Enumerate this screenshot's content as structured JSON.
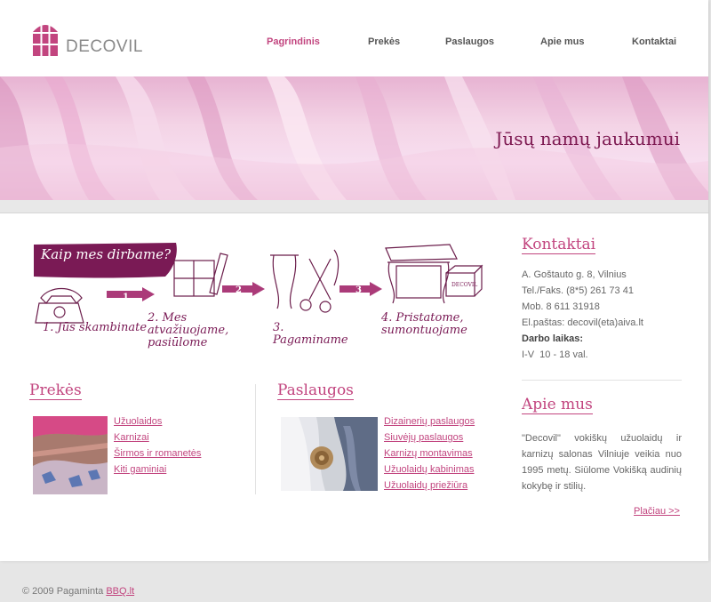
{
  "brand": {
    "name": "DECOVIL"
  },
  "nav": {
    "items": [
      {
        "label": "Pagrindinis",
        "active": true
      },
      {
        "label": "Prekės"
      },
      {
        "label": "Paslaugos"
      },
      {
        "label": "Apie mus"
      },
      {
        "label": "Kontaktai"
      }
    ]
  },
  "banner": {
    "tagline": "Jūsų namų jaukumui"
  },
  "how_we_work": {
    "title": "Kaip mes dirbame?",
    "steps": [
      {
        "number": "1",
        "text": "1. Jūs skambinate"
      },
      {
        "number": "2",
        "text": "2. Mes atvažiuojame, pasiūlome"
      },
      {
        "number": "3",
        "text": "3. Pagaminame"
      },
      {
        "number": "4",
        "text": "4. Pristatome, sumontuojame"
      }
    ],
    "box_label": "DECOVIL"
  },
  "products": {
    "title": "Prekės",
    "links": [
      "Užuolaidos",
      "Karnizai",
      "Širmos ir romanetės",
      "Kiti gaminiai"
    ]
  },
  "services": {
    "title": "Paslaugos",
    "links": [
      "Dizainerių paslaugos",
      "Siuvėjų paslaugos",
      "Karnizų montavimas",
      "Užuolaidų kabinimas",
      "Užuolaidų priežiūra"
    ]
  },
  "contacts": {
    "title": "Kontaktai",
    "address": "A. Goštauto g. 8, Vilnius",
    "phone": "Tel./Faks. (8*5) 261 73 41",
    "mobile": "Mob. 8 611 31918",
    "email": "El.paštas: decovil(eta)aiva.lt",
    "hours_label": "Darbo laikas:",
    "hours": "I-V  10 - 18 val."
  },
  "about": {
    "title": "Apie mus",
    "text": "\"Decovil\" vokiškų užuolaidų ir karnizų salonas Vilniuje veikia nuo 1995 metų. Siūlome Vokišką audinių kokybę ir stilių.",
    "more_label": "Plačiau >>"
  },
  "footer": {
    "copyright": "© 2009 Pagaminta",
    "link_label": "BBQ.lt"
  },
  "colors": {
    "accent": "#c2457f",
    "dark_accent": "#7a1a55"
  }
}
